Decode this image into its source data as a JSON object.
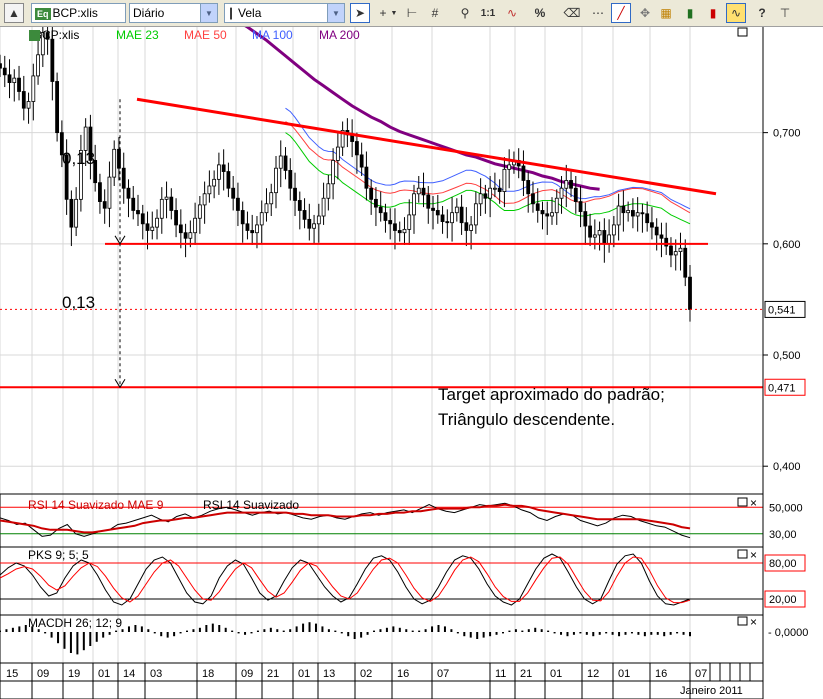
{
  "toolbar": {
    "symbol": "BCP:xlis",
    "period": "Diário",
    "chart_type": "Vela",
    "icons": [
      "cursor-icon",
      "crosshair-icon",
      "dropdown-arrow-icon",
      "grid-icon",
      "zoom-icon",
      "one-to-one-icon",
      "indicator-icon",
      "percent-icon",
      "eraser-icon",
      "dots-icon",
      "trendline-icon",
      "price-label-icon",
      "bar-icon",
      "bar-highlight-icon",
      "help-icon",
      "pin-icon"
    ],
    "one_to_one": "1:1",
    "percent": "%",
    "help": "?"
  },
  "colors": {
    "price_candle": "#000000",
    "mae23": "#00cc00",
    "mae50": "#ff4040",
    "ma100": "#4060ff",
    "ma200": "#800080",
    "trendline": "#ff0000",
    "rsi": "#000000",
    "rsi_mae": "#cc0000",
    "macd_hist": "#000000"
  },
  "chart_data": [
    {
      "type": "candlestick",
      "panel": "price",
      "legend": {
        "symbol": "BCP:xlis",
        "mae23": "MAE 23",
        "mae50": "MAE 50",
        "ma100": "MA 100",
        "ma200": "MA 200"
      },
      "y_ticks": [
        "0,700",
        "0,600",
        "0,500",
        "0,400"
      ],
      "y_tick_values": [
        0.7,
        0.6,
        0.5,
        0.4
      ],
      "ylim": [
        0.375,
        0.795
      ],
      "last_price": 0.541,
      "last_price_label": "0,541",
      "target": 0.471,
      "target_label": "0,471",
      "triangle_base": 0.6,
      "triangle_upper_start": 0.73,
      "triangle_upper_end": 0.645,
      "annotations": {
        "height_upper": "0,13",
        "height_lower": "0,13",
        "note_line1": "Target aproximado do padrão;",
        "note_line2": "Triângulo descendente."
      },
      "closes": [
        0.758,
        0.752,
        0.745,
        0.749,
        0.737,
        0.722,
        0.728,
        0.751,
        0.77,
        0.79,
        0.784,
        0.746,
        0.7,
        0.68,
        0.64,
        0.615,
        0.64,
        0.684,
        0.705,
        0.675,
        0.655,
        0.638,
        0.632,
        0.66,
        0.685,
        0.668,
        0.65,
        0.641,
        0.63,
        0.627,
        0.618,
        0.612,
        0.615,
        0.623,
        0.64,
        0.642,
        0.63,
        0.617,
        0.61,
        0.605,
        0.61,
        0.623,
        0.635,
        0.645,
        0.652,
        0.658,
        0.671,
        0.665,
        0.65,
        0.641,
        0.63,
        0.618,
        0.612,
        0.61,
        0.617,
        0.628,
        0.636,
        0.646,
        0.668,
        0.679,
        0.666,
        0.65,
        0.639,
        0.63,
        0.622,
        0.614,
        0.618,
        0.625,
        0.641,
        0.654,
        0.675,
        0.687,
        0.702,
        0.698,
        0.692,
        0.68,
        0.669,
        0.65,
        0.64,
        0.633,
        0.628,
        0.621,
        0.618,
        0.612,
        0.61,
        0.613,
        0.626,
        0.645,
        0.65,
        0.644,
        0.632,
        0.63,
        0.626,
        0.62,
        0.619,
        0.628,
        0.633,
        0.619,
        0.612,
        0.617,
        0.636,
        0.645,
        0.641,
        0.65,
        0.65,
        0.647,
        0.667,
        0.671,
        0.675,
        0.67,
        0.657,
        0.645,
        0.636,
        0.63,
        0.627,
        0.625,
        0.628,
        0.641,
        0.65,
        0.657,
        0.65,
        0.638,
        0.629,
        0.616,
        0.606,
        0.608,
        0.612,
        0.6,
        0.608,
        0.617,
        0.634,
        0.628,
        0.63,
        0.625,
        0.628,
        0.627,
        0.619,
        0.615,
        0.608,
        0.605,
        0.598,
        0.59,
        0.593,
        0.596,
        0.57,
        0.541
      ],
      "mae23_values": [
        0.7,
        0.697,
        0.692,
        0.686,
        0.68,
        0.674,
        0.67,
        0.666,
        0.663,
        0.662,
        0.662,
        0.659,
        0.655,
        0.652,
        0.649,
        0.646,
        0.643,
        0.64,
        0.637,
        0.635,
        0.634,
        0.633,
        0.633,
        0.634,
        0.636,
        0.637,
        0.637,
        0.637,
        0.636,
        0.636,
        0.636,
        0.636,
        0.637,
        0.638,
        0.64,
        0.642,
        0.644,
        0.646,
        0.648,
        0.648,
        0.647,
        0.645,
        0.643,
        0.64,
        0.637,
        0.633,
        0.63,
        0.63,
        0.63,
        0.631,
        0.633,
        0.635,
        0.637,
        0.638,
        0.639,
        0.639,
        0.639,
        0.637,
        0.634,
        0.631,
        0.628,
        0.626,
        0.625,
        0.625,
        0.626,
        0.627,
        0.627,
        0.628,
        0.629,
        0.631,
        0.633,
        0.634,
        0.635,
        0.636,
        0.636,
        0.636,
        0.635,
        0.634,
        0.633,
        0.632,
        0.629,
        0.626,
        0.624,
        0.622,
        0.62,
        0.618
      ],
      "mae23_start_index": 60,
      "ma200_values": [
        0.8,
        0.795,
        0.789,
        0.783,
        0.776,
        0.769,
        0.762,
        0.755,
        0.748,
        0.742,
        0.736,
        0.73,
        0.724,
        0.719,
        0.714,
        0.71,
        0.705,
        0.701,
        0.698,
        0.695,
        0.692,
        0.689,
        0.686,
        0.683,
        0.68,
        0.678,
        0.675,
        0.672,
        0.67,
        0.668,
        0.666,
        0.664,
        0.661,
        0.659,
        0.656,
        0.654,
        0.652,
        0.65,
        0.649
      ],
      "ma200_start_index": 50,
      "ma200_step": 2
    },
    {
      "type": "line",
      "panel": "rsi",
      "legend": {
        "mae": "RSI 14 Suavizado MAE 9",
        "rsi": "RSI 14 Suavizado"
      },
      "y_ticks": [
        "50,000",
        "30,00"
      ],
      "y_tick_values": [
        50,
        30
      ],
      "ylim": [
        20,
        60
      ],
      "rsi_values": [
        42,
        40,
        37,
        38,
        33,
        28,
        29,
        34,
        37,
        30,
        28,
        30,
        32,
        33,
        37,
        38,
        40,
        42,
        44,
        41,
        39,
        43,
        45,
        42,
        44,
        47,
        49,
        50,
        48,
        46,
        44,
        46,
        47,
        45,
        46,
        44,
        42,
        41,
        43,
        44,
        42,
        41,
        43,
        45,
        46,
        44,
        46,
        47,
        48,
        46,
        49,
        52,
        49,
        47,
        46,
        48,
        50,
        52,
        51,
        52,
        53,
        51,
        48,
        46,
        42,
        40,
        43,
        45,
        44,
        40,
        38,
        36,
        38,
        42,
        44,
        43,
        40,
        38,
        36,
        35,
        32,
        29,
        27
      ],
      "mae_values": [
        40,
        39,
        38,
        37,
        36,
        34,
        33,
        33,
        33,
        32,
        31,
        31,
        32,
        33,
        34,
        35,
        36,
        38,
        39,
        40,
        40,
        41,
        42,
        42,
        43,
        44,
        45,
        46,
        46,
        46,
        46,
        46,
        46,
        46,
        46,
        45,
        45,
        44,
        44,
        44,
        43,
        43,
        43,
        44,
        44,
        45,
        45,
        46,
        46,
        47,
        47,
        48,
        49,
        49,
        49,
        49,
        50,
        50,
        51,
        51,
        52,
        51,
        51,
        50,
        48,
        47,
        46,
        45,
        44,
        43,
        42,
        41,
        41,
        41,
        41,
        41,
        41,
        40,
        39,
        38,
        37,
        35,
        34
      ]
    },
    {
      "type": "line",
      "panel": "stochastic",
      "legend": {
        "name": "PKS 9; 5; 5"
      },
      "y_ticks": [
        "80,00",
        "20,00"
      ],
      "y_tick_values": [
        80,
        20
      ],
      "ylim": [
        0,
        100
      ],
      "k_values": [
        60,
        72,
        80,
        75,
        60,
        40,
        25,
        30,
        55,
        75,
        85,
        80,
        60,
        35,
        15,
        10,
        20,
        45,
        70,
        85,
        90,
        80,
        55,
        30,
        15,
        12,
        25,
        55,
        75,
        85,
        78,
        55,
        30,
        18,
        25,
        50,
        72,
        85,
        80,
        60,
        40,
        25,
        15,
        22,
        45,
        70,
        88,
        92,
        85,
        65,
        40,
        20,
        12,
        18,
        40,
        65,
        85,
        92,
        88,
        70,
        45,
        25,
        15,
        10,
        20,
        45,
        70,
        88,
        95,
        88,
        65,
        40,
        20,
        12,
        20,
        50,
        78,
        92,
        95,
        80,
        50,
        25,
        12,
        10,
        15,
        20
      ],
      "d_values": [
        55,
        62,
        70,
        74,
        70,
        58,
        43,
        35,
        42,
        58,
        72,
        80,
        74,
        58,
        38,
        22,
        15,
        25,
        45,
        65,
        80,
        85,
        75,
        55,
        35,
        20,
        18,
        32,
        52,
        70,
        80,
        72,
        52,
        33,
        23,
        30,
        48,
        68,
        80,
        75,
        58,
        40,
        25,
        20,
        30,
        50,
        70,
        85,
        88,
        80,
        60,
        38,
        22,
        16,
        25,
        45,
        68,
        85,
        90,
        82,
        62,
        40,
        24,
        16,
        16,
        30,
        52,
        72,
        88,
        90,
        78,
        55,
        33,
        18,
        17,
        32,
        58,
        80,
        90,
        88,
        68,
        42,
        22,
        14,
        14,
        18
      ]
    },
    {
      "type": "bar",
      "panel": "macd",
      "legend": {
        "name": "MACDH 26; 12; 9"
      },
      "y_ticks": [
        "0,0000"
      ],
      "ylim": [
        -1,
        1
      ],
      "values": [
        0.05,
        0.1,
        0.15,
        0.2,
        0.25,
        0.2,
        0.1,
        -0.05,
        -0.2,
        -0.4,
        -0.6,
        -0.75,
        -0.8,
        -0.65,
        -0.5,
        -0.35,
        -0.2,
        -0.1,
        0.05,
        0.1,
        0.2,
        0.25,
        0.2,
        0.1,
        -0.05,
        -0.15,
        -0.2,
        -0.15,
        -0.05,
        0.05,
        0.1,
        0.15,
        0.25,
        0.3,
        0.25,
        0.15,
        0.05,
        -0.05,
        -0.1,
        -0.05,
        0.05,
        0.1,
        0.15,
        0.1,
        0.05,
        0.1,
        0.2,
        0.3,
        0.35,
        0.3,
        0.2,
        0.1,
        0.05,
        -0.05,
        -0.15,
        -0.25,
        -0.2,
        -0.1,
        0.05,
        0.1,
        0.15,
        0.2,
        0.15,
        0.1,
        0.05,
        0.05,
        0.1,
        0.2,
        0.25,
        0.2,
        0.1,
        -0.05,
        -0.15,
        -0.2,
        -0.25,
        -0.2,
        -0.15,
        -0.1,
        -0.05,
        0.05,
        0.1,
        0.05,
        0.1,
        0.15,
        0.1,
        0.05,
        -0.05,
        -0.1,
        -0.15,
        -0.1,
        -0.05,
        -0.1,
        -0.15,
        -0.1,
        -0.05,
        -0.1,
        -0.15,
        -0.1,
        -0.05,
        -0.1,
        -0.15,
        -0.1,
        -0.1,
        -0.15,
        -0.1,
        -0.05,
        -0.1,
        -0.15
      ]
    }
  ],
  "x_axis": {
    "ticks": [
      "15",
      "09",
      "19",
      "01",
      "14",
      "03",
      "18",
      "09",
      "21",
      "01",
      "13",
      "02",
      "16",
      "07",
      "11",
      "21",
      "01",
      "12",
      "01",
      "16",
      "07"
    ],
    "month_label": "Janeiro 2011"
  }
}
